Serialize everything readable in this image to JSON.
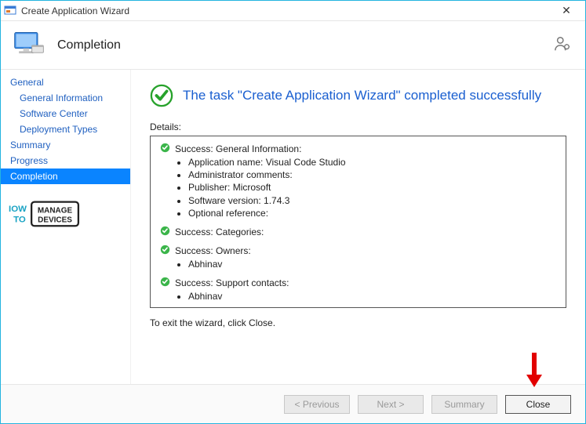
{
  "window": {
    "title": "Create Application Wizard"
  },
  "banner": {
    "title": "Completion"
  },
  "sidebar": {
    "items": [
      {
        "label": "General",
        "indent": 0
      },
      {
        "label": "General Information",
        "indent": 1
      },
      {
        "label": "Software Center",
        "indent": 1
      },
      {
        "label": "Deployment Types",
        "indent": 1
      },
      {
        "label": "Summary",
        "indent": 0
      },
      {
        "label": "Progress",
        "indent": 0
      },
      {
        "label": "Completion",
        "indent": 0,
        "selected": true
      }
    ]
  },
  "headline": "The task \"Create Application Wizard\" completed successfully",
  "details_label": "Details:",
  "details": [
    {
      "title": "Success: General Information:",
      "items": [
        "Application name: Visual Code Studio",
        "Administrator comments:",
        "Publisher: Microsoft",
        "Software version: 1.74.3",
        "Optional reference:"
      ]
    },
    {
      "title": "Success: Categories:",
      "items": []
    },
    {
      "title": "Success: Owners:",
      "items": [
        "Abhinav"
      ]
    },
    {
      "title": "Success: Support contacts:",
      "items": [
        "Abhinav"
      ]
    }
  ],
  "exit_text": "To exit the wizard, click Close.",
  "footer": {
    "previous": "< Previous",
    "next": "Next >",
    "summary": "Summary",
    "close": "Close"
  },
  "watermark": {
    "line1": "IOW",
    "line2": "TO",
    "box1": "MANAGE",
    "box2": "DEVICES"
  }
}
